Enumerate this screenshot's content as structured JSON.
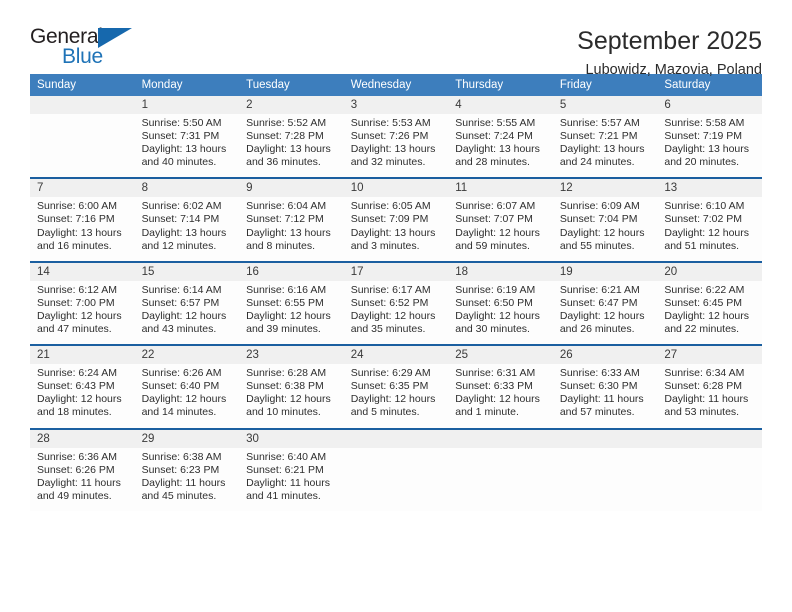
{
  "brand": {
    "name_top": "General",
    "name_bottom": "Blue",
    "triangle_color": "#1668ad",
    "blue_color": "#1f73b7"
  },
  "header": {
    "title": "September 2025",
    "subtitle": "Lubowidz, Mazovia, Poland"
  },
  "theme": {
    "header_bg": "#3d7ebd",
    "week_separator": "#1b5fa0",
    "daynum_bg": "#f0f0f0"
  },
  "calendar": {
    "day_headers": [
      "Sunday",
      "Monday",
      "Tuesday",
      "Wednesday",
      "Thursday",
      "Friday",
      "Saturday"
    ],
    "weeks": [
      {
        "days": [
          {
            "num": "",
            "l1": "",
            "l2": "",
            "l3": "",
            "l4": ""
          },
          {
            "num": "1",
            "l1": "Sunrise: 5:50 AM",
            "l2": "Sunset: 7:31 PM",
            "l3": "Daylight: 13 hours",
            "l4": "and 40 minutes."
          },
          {
            "num": "2",
            "l1": "Sunrise: 5:52 AM",
            "l2": "Sunset: 7:28 PM",
            "l3": "Daylight: 13 hours",
            "l4": "and 36 minutes."
          },
          {
            "num": "3",
            "l1": "Sunrise: 5:53 AM",
            "l2": "Sunset: 7:26 PM",
            "l3": "Daylight: 13 hours",
            "l4": "and 32 minutes."
          },
          {
            "num": "4",
            "l1": "Sunrise: 5:55 AM",
            "l2": "Sunset: 7:24 PM",
            "l3": "Daylight: 13 hours",
            "l4": "and 28 minutes."
          },
          {
            "num": "5",
            "l1": "Sunrise: 5:57 AM",
            "l2": "Sunset: 7:21 PM",
            "l3": "Daylight: 13 hours",
            "l4": "and 24 minutes."
          },
          {
            "num": "6",
            "l1": "Sunrise: 5:58 AM",
            "l2": "Sunset: 7:19 PM",
            "l3": "Daylight: 13 hours",
            "l4": "and 20 minutes."
          }
        ]
      },
      {
        "days": [
          {
            "num": "7",
            "l1": "Sunrise: 6:00 AM",
            "l2": "Sunset: 7:16 PM",
            "l3": "Daylight: 13 hours",
            "l4": "and 16 minutes."
          },
          {
            "num": "8",
            "l1": "Sunrise: 6:02 AM",
            "l2": "Sunset: 7:14 PM",
            "l3": "Daylight: 13 hours",
            "l4": "and 12 minutes."
          },
          {
            "num": "9",
            "l1": "Sunrise: 6:04 AM",
            "l2": "Sunset: 7:12 PM",
            "l3": "Daylight: 13 hours",
            "l4": "and 8 minutes."
          },
          {
            "num": "10",
            "l1": "Sunrise: 6:05 AM",
            "l2": "Sunset: 7:09 PM",
            "l3": "Daylight: 13 hours",
            "l4": "and 3 minutes."
          },
          {
            "num": "11",
            "l1": "Sunrise: 6:07 AM",
            "l2": "Sunset: 7:07 PM",
            "l3": "Daylight: 12 hours",
            "l4": "and 59 minutes."
          },
          {
            "num": "12",
            "l1": "Sunrise: 6:09 AM",
            "l2": "Sunset: 7:04 PM",
            "l3": "Daylight: 12 hours",
            "l4": "and 55 minutes."
          },
          {
            "num": "13",
            "l1": "Sunrise: 6:10 AM",
            "l2": "Sunset: 7:02 PM",
            "l3": "Daylight: 12 hours",
            "l4": "and 51 minutes."
          }
        ]
      },
      {
        "days": [
          {
            "num": "14",
            "l1": "Sunrise: 6:12 AM",
            "l2": "Sunset: 7:00 PM",
            "l3": "Daylight: 12 hours",
            "l4": "and 47 minutes."
          },
          {
            "num": "15",
            "l1": "Sunrise: 6:14 AM",
            "l2": "Sunset: 6:57 PM",
            "l3": "Daylight: 12 hours",
            "l4": "and 43 minutes."
          },
          {
            "num": "16",
            "l1": "Sunrise: 6:16 AM",
            "l2": "Sunset: 6:55 PM",
            "l3": "Daylight: 12 hours",
            "l4": "and 39 minutes."
          },
          {
            "num": "17",
            "l1": "Sunrise: 6:17 AM",
            "l2": "Sunset: 6:52 PM",
            "l3": "Daylight: 12 hours",
            "l4": "and 35 minutes."
          },
          {
            "num": "18",
            "l1": "Sunrise: 6:19 AM",
            "l2": "Sunset: 6:50 PM",
            "l3": "Daylight: 12 hours",
            "l4": "and 30 minutes."
          },
          {
            "num": "19",
            "l1": "Sunrise: 6:21 AM",
            "l2": "Sunset: 6:47 PM",
            "l3": "Daylight: 12 hours",
            "l4": "and 26 minutes."
          },
          {
            "num": "20",
            "l1": "Sunrise: 6:22 AM",
            "l2": "Sunset: 6:45 PM",
            "l3": "Daylight: 12 hours",
            "l4": "and 22 minutes."
          }
        ]
      },
      {
        "days": [
          {
            "num": "21",
            "l1": "Sunrise: 6:24 AM",
            "l2": "Sunset: 6:43 PM",
            "l3": "Daylight: 12 hours",
            "l4": "and 18 minutes."
          },
          {
            "num": "22",
            "l1": "Sunrise: 6:26 AM",
            "l2": "Sunset: 6:40 PM",
            "l3": "Daylight: 12 hours",
            "l4": "and 14 minutes."
          },
          {
            "num": "23",
            "l1": "Sunrise: 6:28 AM",
            "l2": "Sunset: 6:38 PM",
            "l3": "Daylight: 12 hours",
            "l4": "and 10 minutes."
          },
          {
            "num": "24",
            "l1": "Sunrise: 6:29 AM",
            "l2": "Sunset: 6:35 PM",
            "l3": "Daylight: 12 hours",
            "l4": "and 5 minutes."
          },
          {
            "num": "25",
            "l1": "Sunrise: 6:31 AM",
            "l2": "Sunset: 6:33 PM",
            "l3": "Daylight: 12 hours",
            "l4": "and 1 minute."
          },
          {
            "num": "26",
            "l1": "Sunrise: 6:33 AM",
            "l2": "Sunset: 6:30 PM",
            "l3": "Daylight: 11 hours",
            "l4": "and 57 minutes."
          },
          {
            "num": "27",
            "l1": "Sunrise: 6:34 AM",
            "l2": "Sunset: 6:28 PM",
            "l3": "Daylight: 11 hours",
            "l4": "and 53 minutes."
          }
        ]
      },
      {
        "days": [
          {
            "num": "28",
            "l1": "Sunrise: 6:36 AM",
            "l2": "Sunset: 6:26 PM",
            "l3": "Daylight: 11 hours",
            "l4": "and 49 minutes."
          },
          {
            "num": "29",
            "l1": "Sunrise: 6:38 AM",
            "l2": "Sunset: 6:23 PM",
            "l3": "Daylight: 11 hours",
            "l4": "and 45 minutes."
          },
          {
            "num": "30",
            "l1": "Sunrise: 6:40 AM",
            "l2": "Sunset: 6:21 PM",
            "l3": "Daylight: 11 hours",
            "l4": "and 41 minutes."
          },
          {
            "num": "",
            "l1": "",
            "l2": "",
            "l3": "",
            "l4": ""
          },
          {
            "num": "",
            "l1": "",
            "l2": "",
            "l3": "",
            "l4": ""
          },
          {
            "num": "",
            "l1": "",
            "l2": "",
            "l3": "",
            "l4": ""
          },
          {
            "num": "",
            "l1": "",
            "l2": "",
            "l3": "",
            "l4": ""
          }
        ]
      }
    ]
  }
}
